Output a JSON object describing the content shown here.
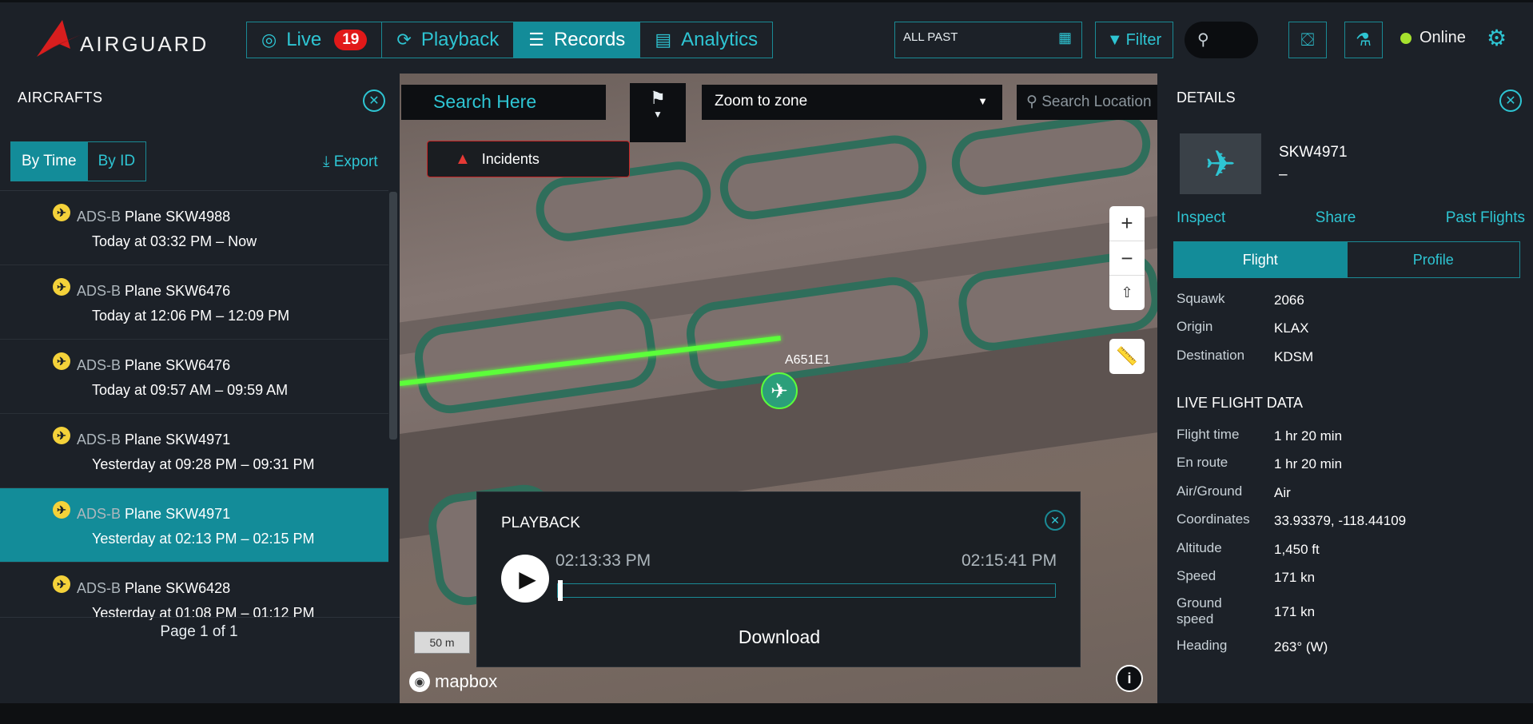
{
  "brand": {
    "name": "AIRGUARD"
  },
  "nav": {
    "tabs": [
      {
        "label": "Live",
        "badge": "19"
      },
      {
        "label": "Playback"
      },
      {
        "label": "Records"
      },
      {
        "label": "Analytics"
      }
    ],
    "active": "Records"
  },
  "toolbar": {
    "date_range": "ALL PAST",
    "filter_label": "Filter",
    "status": "Online"
  },
  "left_panel": {
    "title": "AIRCRAFTS",
    "sort_tabs": [
      "By Time",
      "By ID"
    ],
    "export_label": "Export",
    "items": [
      {
        "source": "ADS-B",
        "type": "Plane",
        "callsign": "SKW4988",
        "time": "Today at 03:32 PM – Now"
      },
      {
        "source": "ADS-B",
        "type": "Plane",
        "callsign": "SKW6476",
        "time": "Today at 12:06 PM – 12:09 PM"
      },
      {
        "source": "ADS-B",
        "type": "Plane",
        "callsign": "SKW6476",
        "time": "Today at 09:57 AM – 09:59 AM"
      },
      {
        "source": "ADS-B",
        "type": "Plane",
        "callsign": "SKW4971",
        "time": "Yesterday at 09:28 PM – 09:31 PM"
      },
      {
        "source": "ADS-B",
        "type": "Plane",
        "callsign": "SKW4971",
        "time": "Yesterday at 02:13 PM – 02:15 PM"
      },
      {
        "source": "ADS-B",
        "type": "Plane",
        "callsign": "SKW6428",
        "time": "Yesterday at 01:08 PM – 01:12 PM"
      }
    ],
    "selected_index": 4,
    "pagination": "Page 1 of 1"
  },
  "map": {
    "search_placeholder": "Search Here",
    "zoom_select": "Zoom to zone",
    "location_placeholder": "Search Location",
    "incidents_label": "Incidents",
    "aircraft_label": "A651E1",
    "scale_label": "50 m",
    "attribution": "mapbox",
    "track_color": "#5cff3a"
  },
  "playback": {
    "title": "PLAYBACK",
    "start_time": "02:13:33 PM",
    "end_time": "02:15:41 PM",
    "progress": 0,
    "download_label": "Download"
  },
  "details": {
    "title": "DETAILS",
    "callsign": "SKW4971",
    "subtitle": "–",
    "links": [
      "Inspect",
      "Share",
      "Past Flights"
    ],
    "tabs": [
      "Flight",
      "Profile"
    ],
    "active_tab": "Flight",
    "fields": [
      {
        "label": "Squawk",
        "value": "2066"
      },
      {
        "label": "Origin",
        "value": "KLAX"
      },
      {
        "label": "Destination",
        "value": "KDSM"
      }
    ],
    "live_title": "LIVE FLIGHT DATA",
    "live_fields": [
      {
        "label": "Flight time",
        "value": "1 hr 20 min"
      },
      {
        "label": "En route",
        "value": "1 hr 20 min"
      },
      {
        "label": "Air/Ground",
        "value": "Air"
      },
      {
        "label": "Coordinates",
        "value": "33.93379, -118.44109"
      },
      {
        "label": "Altitude",
        "value": "1,450 ft"
      },
      {
        "label": "Speed",
        "value": "171 kn"
      },
      {
        "label": "Ground speed",
        "value": "171 kn"
      },
      {
        "label": "Heading",
        "value": "263° (W)"
      }
    ]
  },
  "colors": {
    "accent": "#138c99",
    "accent_text": "#2ec5d3",
    "alert": "#e11919",
    "online": "#a6e22e"
  }
}
